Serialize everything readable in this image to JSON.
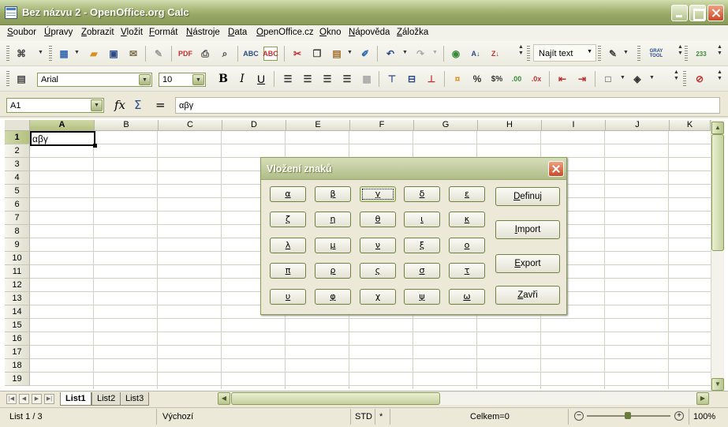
{
  "window": {
    "title": "Bez názvu 2 - OpenOffice.org Calc"
  },
  "menu": [
    "Soubor",
    "Úpravy",
    "Zobrazit",
    "Vložit",
    "Formát",
    "Nástroje",
    "Data",
    "OpenOffice.cz",
    "Okno",
    "Nápověda",
    "Záložka"
  ],
  "toolbar": {
    "find_text": "Najít text"
  },
  "format_bar": {
    "font_name": "Arial",
    "font_size": "10"
  },
  "formula_bar": {
    "cell_ref": "A1",
    "content": "αβγ"
  },
  "columns": [
    "A",
    "B",
    "C",
    "D",
    "E",
    "F",
    "G",
    "H",
    "I",
    "J",
    "K"
  ],
  "rows": [
    "1",
    "2",
    "3",
    "4",
    "5",
    "6",
    "7",
    "8",
    "9",
    "10",
    "11",
    "12",
    "13",
    "14",
    "15",
    "16",
    "17",
    "18",
    "19"
  ],
  "cells": {
    "A1": "αβγ"
  },
  "sheets": {
    "tabs": [
      "List1",
      "List2",
      "List3"
    ],
    "active": "List1"
  },
  "status": {
    "sheet": "List 1 / 3",
    "style": "Výchozí",
    "mode": "STD",
    "modified": "*",
    "sum": "Celkem=0",
    "zoom": "100%"
  },
  "dialog": {
    "title": "Vložení znaků",
    "chars": [
      "α",
      "β",
      "γ",
      "δ",
      "ε",
      "ζ",
      "η",
      "θ",
      "ι",
      "κ",
      "λ",
      "μ",
      "ν",
      "ξ",
      "ο",
      "π",
      "ρ",
      "ς",
      "σ",
      "τ",
      "υ",
      "φ",
      "χ",
      "ψ",
      "ω"
    ],
    "buttons": [
      "Definuj",
      "Import",
      "Export",
      "Zavři"
    ]
  }
}
